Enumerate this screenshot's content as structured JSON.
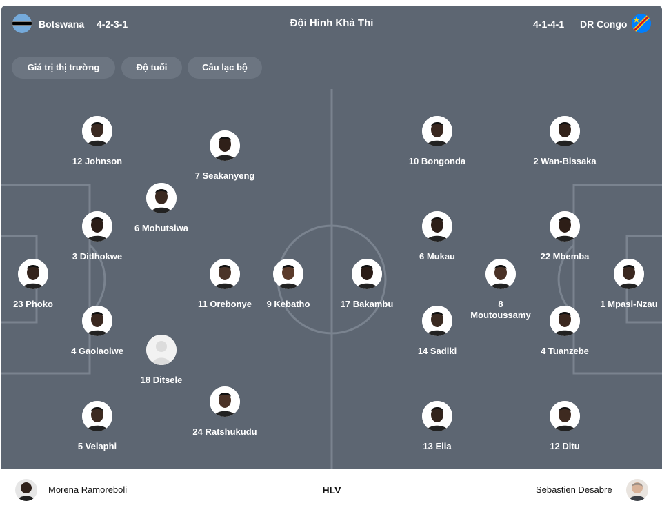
{
  "header": {
    "home_team": "Botswana",
    "home_formation": "4-2-3-1",
    "title": "Đội Hình Khả Thi",
    "away_formation": "4-1-4-1",
    "away_team": "DR Congo",
    "home_flag_icon": "botswana-flag-icon",
    "away_flag_icon": "dr-congo-flag-icon"
  },
  "filters": [
    "Giá trị thị trường",
    "Độ tuổi",
    "Câu lạc bộ"
  ],
  "home_players": [
    {
      "label": "12 Johnson",
      "skin": "#3b2a22"
    },
    {
      "label": "7 Seakanyeng",
      "skin": "#2f2019"
    },
    {
      "label": "6 Mohutsiwa",
      "skin": "#3a2920"
    },
    {
      "label": "3 Ditlhokwe",
      "skin": "#2b1d17"
    },
    {
      "label": "23 Phoko",
      "skin": "#35241c"
    },
    {
      "label": "11 Orebonye",
      "skin": "#4a3428"
    },
    {
      "label": "9 Kebatho",
      "skin": "#5a3a2a"
    },
    {
      "label": "4 Gaolaolwe",
      "skin": "#3a2820"
    },
    {
      "label": "18 Ditsele",
      "skin": "placeholder"
    },
    {
      "label": "5 Velaphi",
      "skin": "#3d2a20"
    },
    {
      "label": "24 Ratshukudu",
      "skin": "#4b3327"
    }
  ],
  "away_players": [
    {
      "label": "10 Bongonda",
      "skin": "#3a2820"
    },
    {
      "label": "2 Wan-Bissaka",
      "skin": "#33231b"
    },
    {
      "label": "6 Mukau",
      "skin": "#2e1f18"
    },
    {
      "label": "22 Mbemba",
      "skin": "#2d1e17"
    },
    {
      "label": "17 Bakambu",
      "skin": "#2a1c16"
    },
    {
      "label": "8\nMoutoussamy",
      "skin": "#4a3226"
    },
    {
      "label": "1 Mpasi-Nzau",
      "skin": "#3a2820"
    },
    {
      "label": "14 Sadiki",
      "skin": "#3a2a21"
    },
    {
      "label": "4 Tuanzebe",
      "skin": "#3b281f"
    },
    {
      "label": "13 Elia",
      "skin": "#33241c"
    },
    {
      "label": "12 Ditu",
      "skin": "#3e2a20"
    }
  ],
  "coaches": {
    "label": "HLV",
    "home_coach": "Morena Ramoreboli",
    "away_coach": "Sebastien Desabre"
  },
  "colors": {
    "pitch": "#5d6672",
    "lines": "#7a838f",
    "pill": "#6c7581"
  }
}
